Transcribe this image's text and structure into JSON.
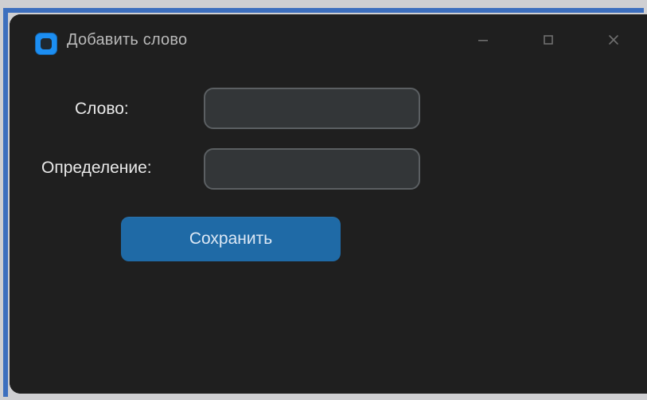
{
  "window": {
    "title": "Добавить слово",
    "controls": {
      "minimize_icon": "minimize-icon",
      "maximize_icon": "maximize-icon",
      "close_icon": "close-icon"
    }
  },
  "form": {
    "word": {
      "label": "Слово:",
      "value": "",
      "placeholder": ""
    },
    "definition": {
      "label": "Определение:",
      "value": "",
      "placeholder": ""
    },
    "save_button_label": "Сохранить"
  },
  "colors": {
    "accent_blue": "#1f6aa6",
    "app_icon_blue": "#1c8ef2",
    "window_bg": "#1f1f1f"
  }
}
